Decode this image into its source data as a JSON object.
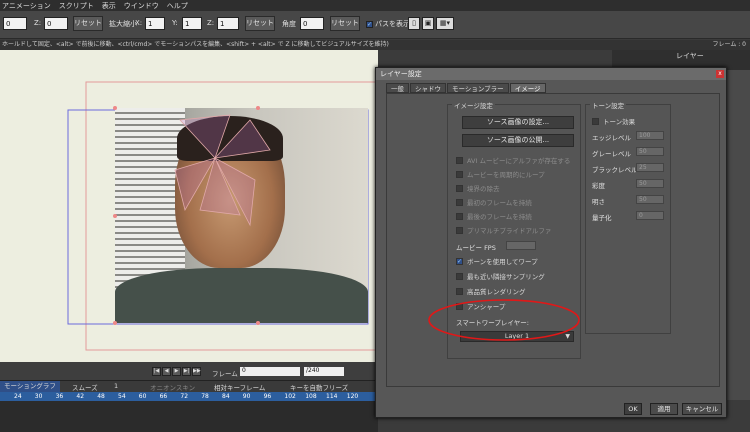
{
  "menubar": {
    "items": [
      "アニメーション",
      "スクリプト",
      "表示",
      "ウインドウ",
      "ヘルプ"
    ]
  },
  "toolbar": {
    "x_value": "0",
    "z_label": "Z:",
    "z_value": "0",
    "reset1": "リセット",
    "scale_label": "拡大縮小",
    "sx_label": "X:",
    "sx_value": "1",
    "sy_label": "Y:",
    "sy_value": "1",
    "sz_label": "Z:",
    "sz_value": "1",
    "reset2": "リセット",
    "angle_label": "角度",
    "angle_value": "0",
    "reset3": "リセット",
    "path_label": "パスを表示"
  },
  "hint": "ホールドして固定、<alt> で前後に移動、<ctrl/cmd> でモーションパスを編集、<shift> + <alt> で Z に移動してビジュアルサイズを維持)",
  "frame_label": "フレーム : 0",
  "right_panel_title": "レイヤー",
  "timeline": {
    "frame_label": "フレーム",
    "frame_value": "0",
    "frame_total": "/240",
    "motion_graph": "モーショングラフ",
    "smooth": "スムーズ",
    "smooth_val": "1",
    "onion": "オニオンスキン",
    "relative_key": "相対キーフレーム",
    "key_freeze": "キーを自動フリーズ",
    "ruler": [
      "24",
      "30",
      "36",
      "42",
      "48",
      "54",
      "60",
      "66",
      "72",
      "78",
      "84",
      "90",
      "96",
      "102",
      "108",
      "114",
      "120"
    ]
  },
  "dialog": {
    "title": "レイヤー設定",
    "close": "x",
    "tabs": [
      "一般",
      "シャドウ",
      "モーションブラー",
      "イメージ"
    ],
    "image_group_title": "イメージ設定",
    "source_settings": "ソース画像の設定...",
    "source_reset": "ソース画像の公開...",
    "options": [
      {
        "label": "AVI ムービーにアルファが存在する",
        "enabled": false,
        "checked": false
      },
      {
        "label": "ムービーを周期的にループ",
        "enabled": false,
        "checked": false
      },
      {
        "label": "境界の除去",
        "enabled": false,
        "checked": false
      },
      {
        "label": "最初のフレームを持続",
        "enabled": false,
        "checked": false
      },
      {
        "label": "最後のフレームを持続",
        "enabled": false,
        "checked": false
      },
      {
        "label": "プリマルチプライドアルファ",
        "enabled": false,
        "checked": false
      }
    ],
    "fps_label": "ムービー FPS",
    "options2": [
      {
        "label": "ボーンを使用してワープ",
        "enabled": true,
        "checked": true
      },
      {
        "label": "最も近い隣接サンプリング",
        "enabled": true,
        "checked": false
      },
      {
        "label": "高品質レンダリング",
        "enabled": true,
        "checked": false
      },
      {
        "label": "アンシャープ",
        "enabled": true,
        "checked": false
      }
    ],
    "smart_warp_label": "スマートワープレイヤー:",
    "smart_warp_value": "Layer 1",
    "toon_group_title": "トーン設定",
    "toon_effect": "トーン効果",
    "toon_fields": [
      {
        "label": "エッジレベル",
        "value": "100"
      },
      {
        "label": "グレーレベル",
        "value": "50"
      },
      {
        "label": "ブラックレベル",
        "value": "25"
      },
      {
        "label": "彩度",
        "value": "50"
      },
      {
        "label": "明さ",
        "value": "50"
      },
      {
        "label": "量子化",
        "value": "0"
      }
    ],
    "ok": "OK",
    "apply": "適用",
    "cancel": "キャンセル"
  }
}
